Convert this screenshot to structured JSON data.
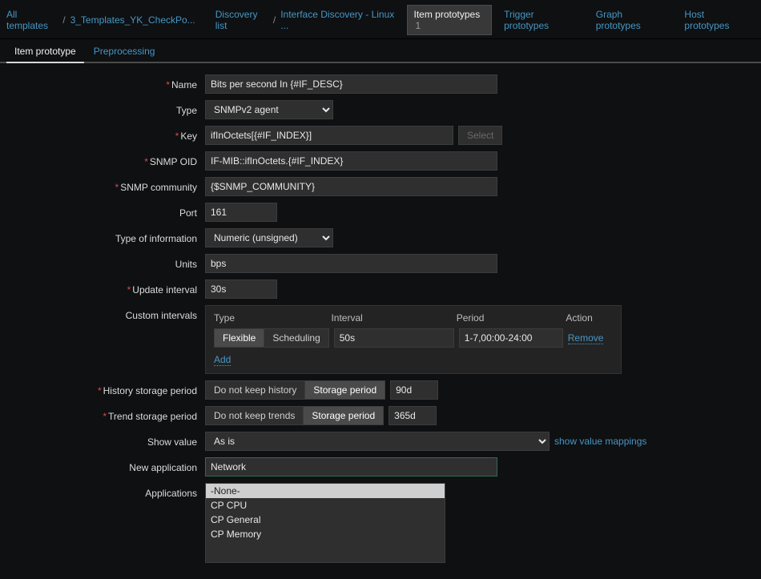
{
  "breadcrumb": {
    "all_templates": "All templates",
    "template": "3_Templates_YK_CheckPo...",
    "discovery_list": "Discovery list",
    "discovery_rule": "Interface Discovery - Linux ..."
  },
  "rtabs": {
    "item_prototypes": "Item prototypes",
    "item_prototypes_count": "1",
    "trigger_prototypes": "Trigger prototypes",
    "graph_prototypes": "Graph prototypes",
    "host_prototypes": "Host prototypes"
  },
  "subtabs": {
    "item_prototype": "Item prototype",
    "preprocessing": "Preprocessing"
  },
  "labels": {
    "name": "Name",
    "type": "Type",
    "key": "Key",
    "snmp_oid": "SNMP OID",
    "snmp_community": "SNMP community",
    "port": "Port",
    "type_of_info": "Type of information",
    "units": "Units",
    "update_interval": "Update interval",
    "custom_intervals": "Custom intervals",
    "history": "History storage period",
    "trend": "Trend storage period",
    "show_value": "Show value",
    "new_application": "New application",
    "applications": "Applications"
  },
  "ci_headers": {
    "type": "Type",
    "interval": "Interval",
    "period": "Period",
    "action": "Action"
  },
  "buttons": {
    "select": "Select",
    "flexible": "Flexible",
    "scheduling": "Scheduling",
    "remove": "Remove",
    "add": "Add",
    "no_history": "Do not keep history",
    "no_trends": "Do not keep trends",
    "storage_period": "Storage period"
  },
  "links": {
    "show_value_mappings": "show value mappings"
  },
  "values": {
    "name": "Bits per second In {#IF_DESC}",
    "type": "SNMPv2 agent",
    "key": "ifInOctets[{#IF_INDEX}]",
    "snmp_oid": "IF-MIB::ifInOctets.{#IF_INDEX}",
    "snmp_community": "{$SNMP_COMMUNITY}",
    "port": "161",
    "type_of_info": "Numeric (unsigned)",
    "units": "bps",
    "update_interval": "30s",
    "ci_interval": "50s",
    "ci_period": "1-7,00:00-24:00",
    "history_period": "90d",
    "trend_period": "365d",
    "show_value": "As is",
    "new_application": "Network"
  },
  "applications": {
    "none": "-None-",
    "cp_cpu": "CP CPU",
    "cp_general": "CP General",
    "cp_memory": "CP Memory"
  }
}
